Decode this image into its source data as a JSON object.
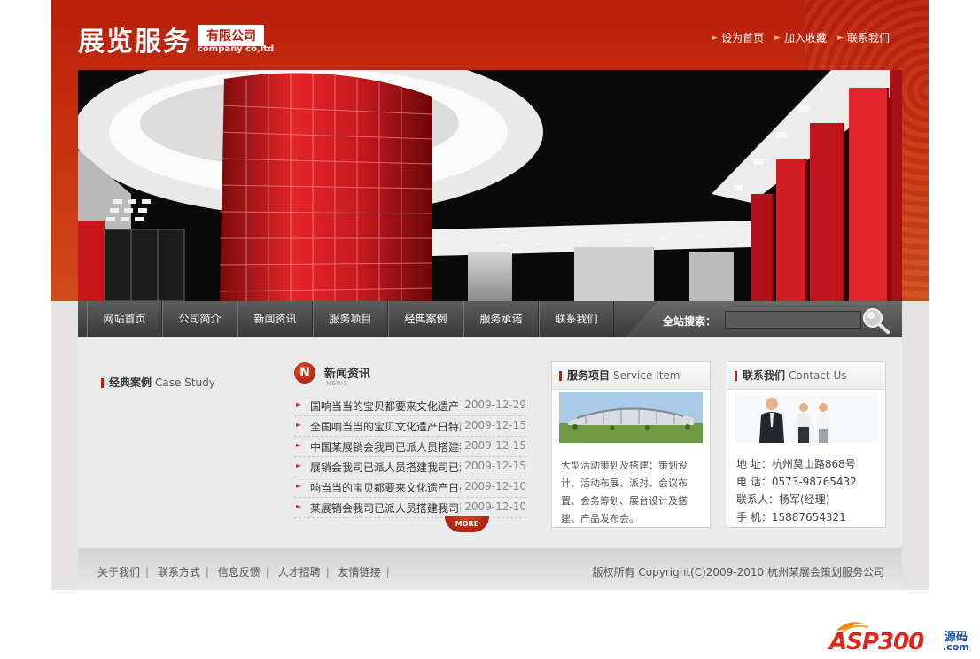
{
  "header": {
    "logo_main": "展览服务",
    "logo_badge": "有限公司",
    "logo_sub": "company co,ltd",
    "top_links": [
      "设为首页",
      "加入收藏",
      "联系我们"
    ]
  },
  "nav": {
    "items": [
      "网站首页",
      "公司简介",
      "新闻资讯",
      "服务项目",
      "经典案例",
      "服务承诺",
      "联系我们"
    ],
    "search_label": "全站搜索：",
    "search_value": ""
  },
  "case_study": {
    "title": "经典案例",
    "title_en": "Case Study"
  },
  "news": {
    "badge": "N",
    "title": "新闻资讯",
    "sub": "NEWS",
    "items": [
      {
        "title": "国响当当的宝贝都要来文化遗产日办",
        "date": "2009-12-29"
      },
      {
        "title": "全国响当当的宝贝文化遗产日特展",
        "date": "2009-12-15"
      },
      {
        "title": "中国某展销会我司已派人员搭建我司",
        "date": "2009-12-15"
      },
      {
        "title": "展销会我司已派人员搭建我司已派人",
        "date": "2009-12-15"
      },
      {
        "title": "响当当的宝贝都要来文化遗产日办特",
        "date": "2009-12-10"
      },
      {
        "title": "某展销会我司已派人员搭建我司已派",
        "date": "2009-12-10"
      }
    ],
    "more": "MORE"
  },
  "service": {
    "title": "服务项目",
    "title_en": "Service Item",
    "text": "大型活动策划及搭建：策划设计、活动布展、派对、会议布置、会务筹划、展台设计及搭建、产品发布会。"
  },
  "contact": {
    "title": "联系我们",
    "title_en": "Contact Us",
    "address": "地 址：杭州莫山路868号",
    "phone": "电 话：0573-98765432",
    "person": "联系人：杨军(经理)",
    "mobile": "手 机：15887654321"
  },
  "footer": {
    "links": [
      "关于我们",
      "联系方式",
      "信息反馈",
      "人才招聘",
      "友情链接"
    ],
    "copyright": "版权所有 Copyright(C)2009-2010 杭州某展会策划服务公司"
  },
  "watermark": {
    "brand": "ASP300",
    "tag": "源码",
    "domain": ".com"
  },
  "colors": {
    "brand_red": "#b81f0d",
    "nav_dark": "#3a3a3a",
    "content_bg": "#ebebeb"
  }
}
